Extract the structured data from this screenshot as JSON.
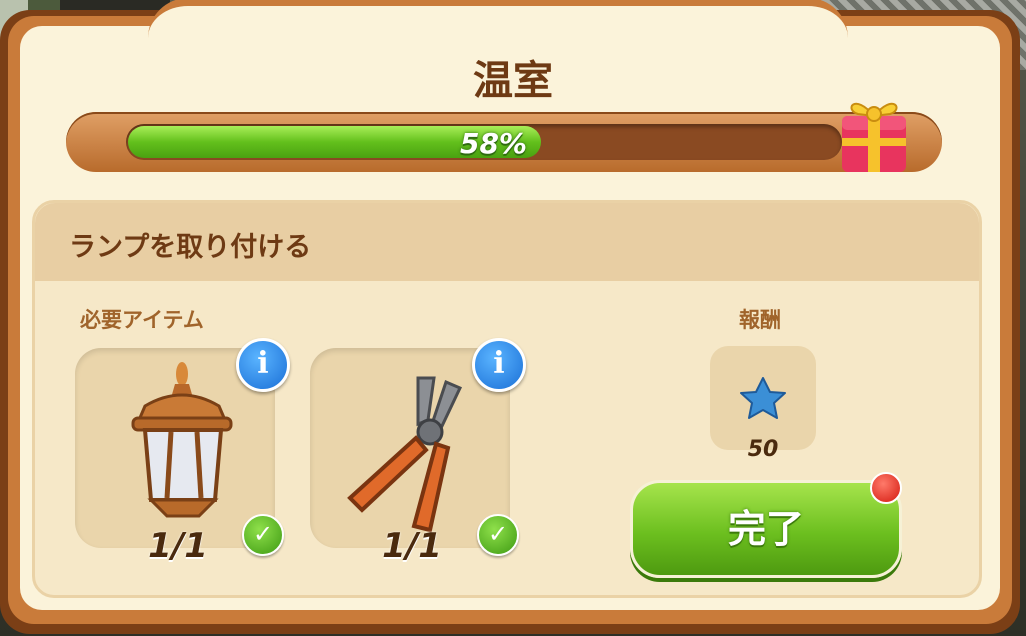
{
  "dialog": {
    "title": "温室",
    "progress": {
      "percent": 58,
      "label": "58%"
    },
    "quest": {
      "title": "ランプを取り付ける",
      "required_items_label": "必要アイテム",
      "reward_label": "報酬",
      "items": [
        {
          "icon": "lantern-icon",
          "count": "1/1",
          "completed": true
        },
        {
          "icon": "pliers-icon",
          "count": "1/1",
          "completed": true
        }
      ],
      "reward": {
        "icon": "blue-star-icon",
        "value": "50"
      },
      "complete_label": "完了"
    }
  },
  "colors": {
    "frame_brown": "#7b3f16",
    "panel_cream": "#fbf3da",
    "progress_green": "#63c01c",
    "button_green": "#6cbf1f",
    "info_blue": "#1a6fd6",
    "notify_red": "#d41a10"
  }
}
